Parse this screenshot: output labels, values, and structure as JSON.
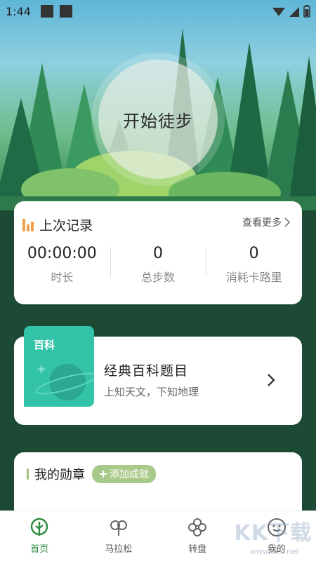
{
  "status_bar": {
    "time": "1:44"
  },
  "hero": {
    "start_label": "开始徒步"
  },
  "last_record": {
    "title": "上次记录",
    "more_label": "查看更多",
    "stats": [
      {
        "value": "00:00:00",
        "label": "时长"
      },
      {
        "value": "0",
        "label": "总步数"
      },
      {
        "value": "0",
        "label": "消耗卡路里"
      }
    ]
  },
  "wiki": {
    "badge": "百科",
    "title": "经典百科题目",
    "subtitle": "上知天文，下知地理"
  },
  "medals": {
    "title": "我的勋章",
    "add_label": "添加成就"
  },
  "nav": {
    "items": [
      {
        "label": "首页",
        "icon": "home-tree-icon",
        "active": true
      },
      {
        "label": "马拉松",
        "icon": "clover-icon",
        "active": false
      },
      {
        "label": "转盘",
        "icon": "flower-icon",
        "active": false
      },
      {
        "label": "我的",
        "icon": "smiley-icon",
        "active": false
      }
    ]
  },
  "watermark": {
    "text": "KK下载",
    "sub": "www.kkx.net"
  },
  "colors": {
    "accent": "#2e8b3e",
    "background": "#1c4a35",
    "orange": "#f0a049",
    "teal": "#33c3a8"
  }
}
